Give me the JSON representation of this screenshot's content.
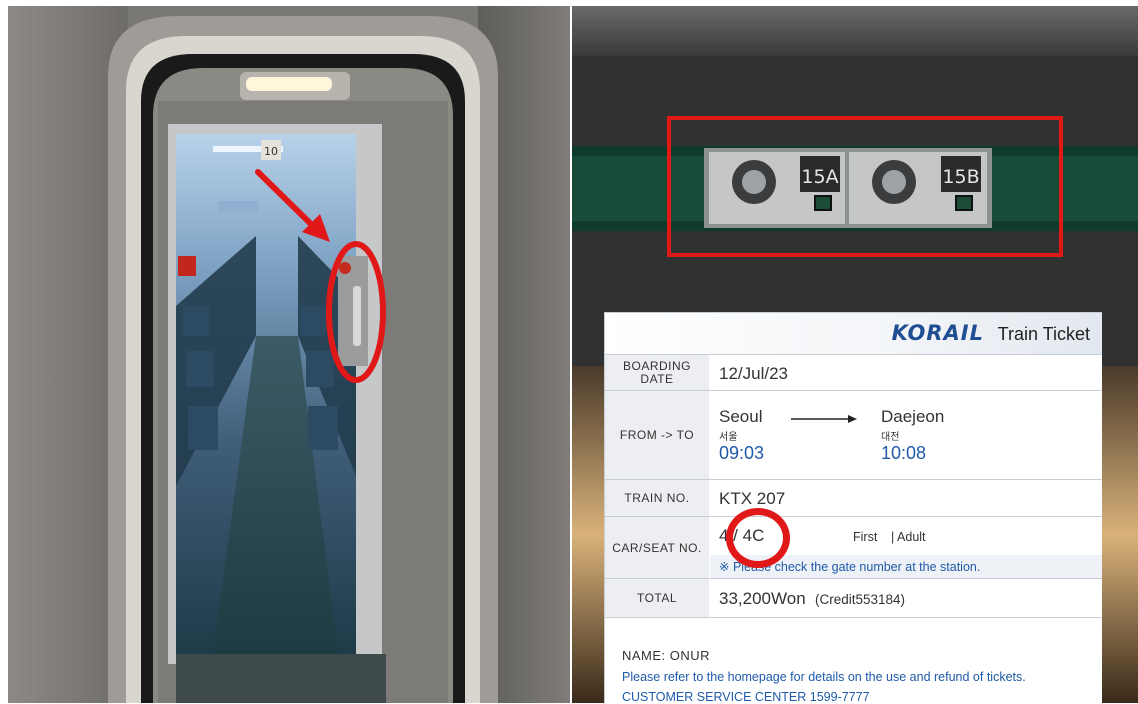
{
  "left_photo": {
    "door_sign": "10"
  },
  "right_photo": {
    "seat_labels": [
      "15A",
      "15B"
    ]
  },
  "ticket": {
    "brand": "KORAIL",
    "title": "Train Ticket",
    "boarding_date_label": "BOARDING DATE",
    "boarding_date_label_line1": "BOARDING",
    "boarding_date_label_line2": "DATE",
    "boarding_date": "12/Jul/23",
    "from_to_label": "FROM -> TO",
    "from_city": "Seoul",
    "from_city_kr": "서울",
    "from_time": "09:03",
    "to_city": "Daejeon",
    "to_city_kr": "대전",
    "to_time": "10:08",
    "train_no_label": "TRAIN NO.",
    "train_no": "KTX 207",
    "car_seat_label": "CAR/SEAT NO.",
    "car_seat": "4 / 4C",
    "class": "First",
    "passenger_type": "| Adult",
    "gate_notice": "※ Please check the gate number at the station.",
    "total_label": "TOTAL",
    "total_amount": "33,200Won",
    "payment": "(Credit553184)",
    "name_line": "NAME: ONUR",
    "refund_notice": "Please refer to the homepage for details on the use and refund of tickets.",
    "customer_service": "CUSTOMER SERVICE CENTER 1599-7777"
  },
  "colors": {
    "highlight_red": "#e01818",
    "ticket_blue": "#1f5aa8",
    "korail_blue": "#1f4e93"
  }
}
